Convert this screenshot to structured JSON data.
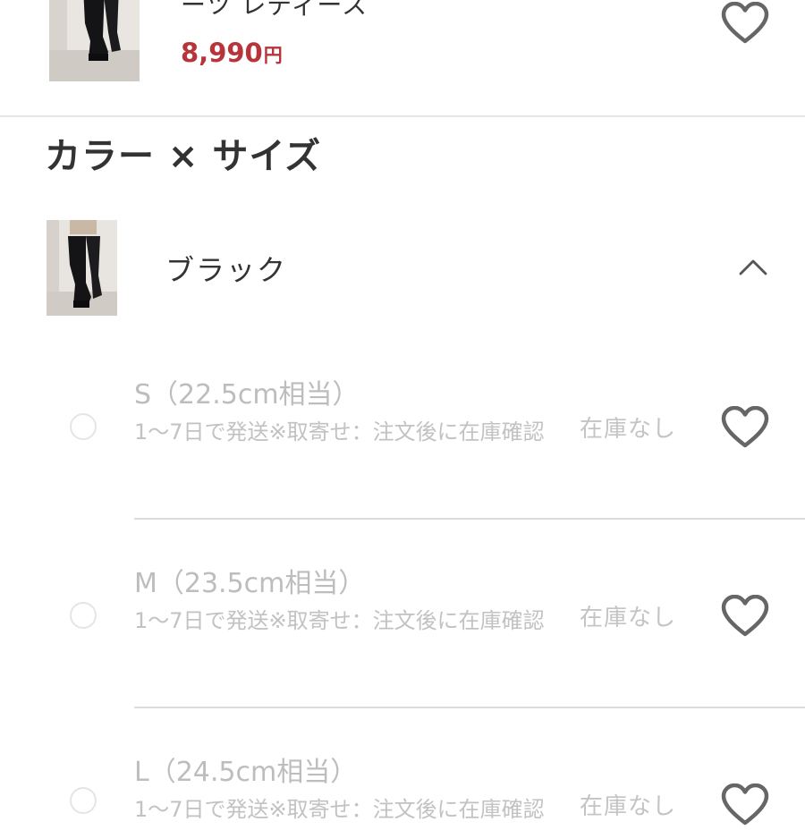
{
  "product": {
    "name": "ーツ レディース",
    "price": "8,990",
    "price_unit": "円"
  },
  "section": {
    "title": "カラー × サイズ"
  },
  "color": {
    "name": "ブラック"
  },
  "sizes": [
    {
      "label": "S（22.5cm相当）",
      "note": "1〜7日で発送※取寄せ：注文後に在庫確認",
      "stock": "在庫なし"
    },
    {
      "label": "M（23.5cm相当）",
      "note": "1〜7日で発送※取寄せ：注文後に在庫確認",
      "stock": "在庫なし"
    },
    {
      "label": "L（24.5cm相当）",
      "note": "1〜7日で発送※取寄せ：注文後に在庫確認",
      "stock": "在庫なし"
    }
  ],
  "icons": {
    "favorite": "heart-outline-icon",
    "collapse": "chevron-up-icon"
  },
  "colors": {
    "price": "#b8343b",
    "text": "#333333",
    "disabled_text": "#bdbdbd",
    "divider": "#dcdcdc"
  }
}
